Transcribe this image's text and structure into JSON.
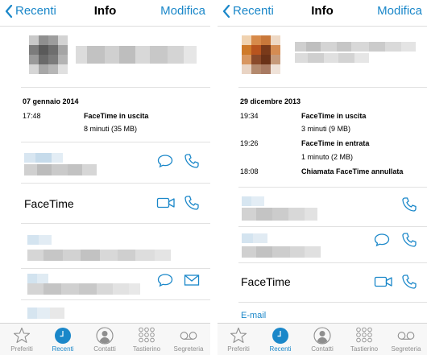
{
  "colors": {
    "accent": "#1a87c9",
    "separator": "#e1e1e1",
    "tab_inactive": "#8e8e8e"
  },
  "left": {
    "nav": {
      "back_label": "Recenti",
      "title": "Info",
      "edit_label": "Modifica"
    },
    "date": "07 gennaio 2014",
    "calls": [
      {
        "time": "17:48",
        "type": "FaceTime in uscita",
        "detail": "8 minuti (35 MB)"
      }
    ],
    "facetime_label": "FaceTime"
  },
  "right": {
    "nav": {
      "back_label": "Recenti",
      "title": "Info",
      "edit_label": "Modifica"
    },
    "date": "29 dicembre 2013",
    "calls": [
      {
        "time": "19:34",
        "type": "FaceTime in uscita",
        "detail": "3 minuti (9 MB)"
      },
      {
        "time": "19:26",
        "type": "FaceTime in entrata",
        "detail": "1 minuto (2 MB)"
      },
      {
        "time": "18:08",
        "type": "Chiamata FaceTime annullata",
        "detail": ""
      }
    ],
    "facetime_label": "FaceTime",
    "email_label": "E-mail"
  },
  "tabbar": {
    "items": [
      {
        "label": "Preferiti",
        "icon": "star-icon",
        "active": false
      },
      {
        "label": "Recenti",
        "icon": "clock-icon",
        "active": true
      },
      {
        "label": "Contatti",
        "icon": "person-icon",
        "active": false
      },
      {
        "label": "Tastierino",
        "icon": "keypad-icon",
        "active": false
      },
      {
        "label": "Segreteria",
        "icon": "voicemail-icon",
        "active": false
      }
    ]
  }
}
